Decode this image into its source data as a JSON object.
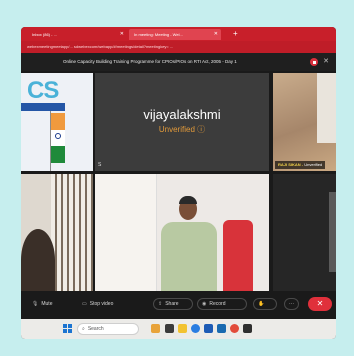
{
  "browser": {
    "tabs": [
      {
        "label": "Inbox (86) - ...",
        "active": false
      },
      {
        "label": "In meeting: Meeting - Wel...",
        "active": true
      }
    ],
    "new_tab_label": "+",
    "url": "webexmeetingmeetapp/... sdwebexcom/webapp/#/meetings/detail?meetingkey= ..."
  },
  "meeting": {
    "title": "Online Capacity Building Training Programme for CPIOs/PIOs on RTI Act, 2005 - Day 1"
  },
  "participants": {
    "ics_logo_text": "CS",
    "vijayalakshmi": {
      "name": "vijayalakshmi",
      "status": "Unverified ⓘ",
      "corner": "S"
    },
    "raji": {
      "label_prefix": "RAJI SIKAN -",
      "label_suffix": "Unverified"
    }
  },
  "controls": {
    "mute": {
      "icon": "mic-icon",
      "label": "Mute"
    },
    "stop_video": {
      "icon": "video-icon",
      "label": "Stop video"
    },
    "share": {
      "icon": "share-icon",
      "label": "Share"
    },
    "record": {
      "icon": "record-icon",
      "label": "Record"
    },
    "hand": "✋",
    "more": "···",
    "leave": "✕"
  },
  "taskbar": {
    "search_label": "Search"
  },
  "colors": {
    "browser_red": "#c81f2a",
    "status_orange": "#e29a3a",
    "leave_red": "#e0303b",
    "page_bg": "#c6eeee"
  }
}
